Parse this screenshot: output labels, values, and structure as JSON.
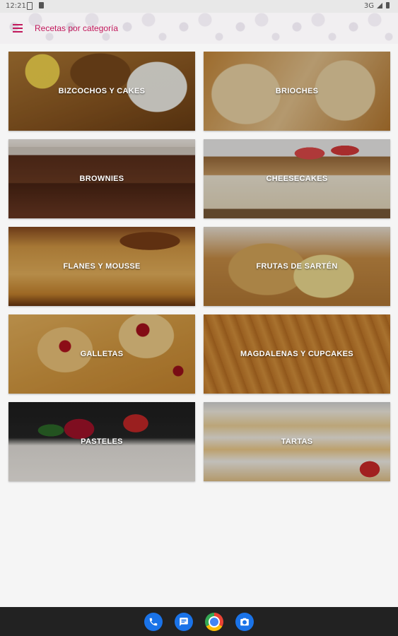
{
  "status_bar": {
    "time": "12:21",
    "network": "3G"
  },
  "app_bar": {
    "title": "Recetas por categoría"
  },
  "categories": [
    {
      "label": "BIZCOCHOS Y CAKES"
    },
    {
      "label": "BRIOCHES"
    },
    {
      "label": "BROWNIES"
    },
    {
      "label": "CHEESECAKES"
    },
    {
      "label": "FLANES Y MOUSSE"
    },
    {
      "label": "FRUTAS DE SARTÉN"
    },
    {
      "label": "GALLETAS"
    },
    {
      "label": "MAGDALENAS Y CUPCAKES"
    },
    {
      "label": "PASTELES"
    },
    {
      "label": "TARTAS"
    }
  ],
  "dock": [
    {
      "name": "phone-icon"
    },
    {
      "name": "messages-icon"
    },
    {
      "name": "chrome-icon"
    },
    {
      "name": "camera-icon"
    }
  ],
  "colors": {
    "accent": "#c2185b",
    "background": "#f5f5f5",
    "nav_bar": "#222222"
  }
}
